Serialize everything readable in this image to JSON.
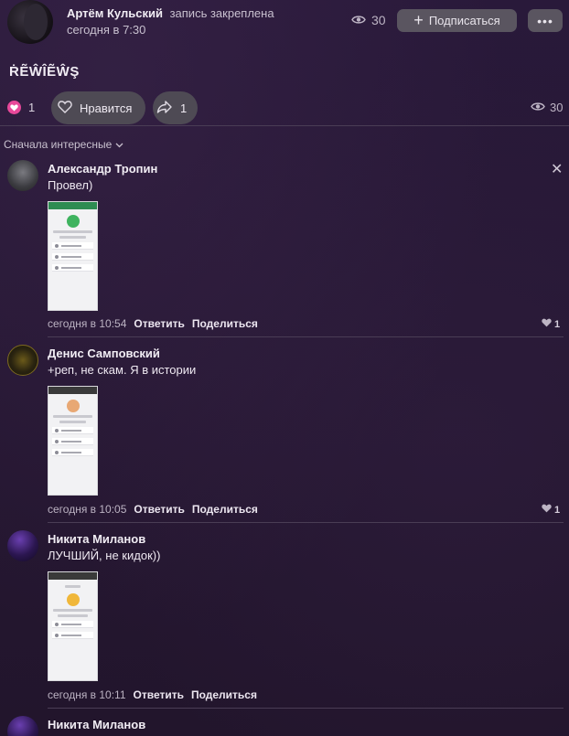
{
  "header": {
    "author_name": "Артём Кульский",
    "author_action": "запись закреплена",
    "time": "сегодня в 7:30",
    "views": "30",
    "subscribe_label": "Подписаться",
    "more_label": "•••"
  },
  "post": {
    "title": "ṘẼŴÎẼŴŞ",
    "like_count": "1",
    "like_label": "Нравится",
    "share_count": "1",
    "views": "30"
  },
  "comments_sort": "Сначала интересные",
  "comments": [
    {
      "author": "Александр Тропин",
      "text": "Провел)",
      "time": "сегодня в 10:54",
      "reply": "Ответить",
      "share": "Поделиться",
      "likes": "1"
    },
    {
      "author": "Денис Самповский",
      "text": "+реп, не скам. Я в истории",
      "time": "сегодня в 10:05",
      "reply": "Ответить",
      "share": "Поделиться",
      "likes": "1"
    },
    {
      "author": "Никита Миланов",
      "text": "ЛУЧШИЙ, не кидок))",
      "time": "сегодня в 10:11",
      "reply": "Ответить",
      "share": "Поделиться",
      "likes": ""
    },
    {
      "author": "Никита Миланов"
    }
  ],
  "colors": {
    "background": "#25172f",
    "heart_accent": "#e8489a",
    "button_bg": "#5a5560"
  },
  "icons": {
    "eye": "eye-icon",
    "plus": "plus-icon",
    "heart": "heart-icon",
    "share": "share-arrow-icon",
    "close": "close-icon",
    "chevron": "chevron-down-icon"
  }
}
